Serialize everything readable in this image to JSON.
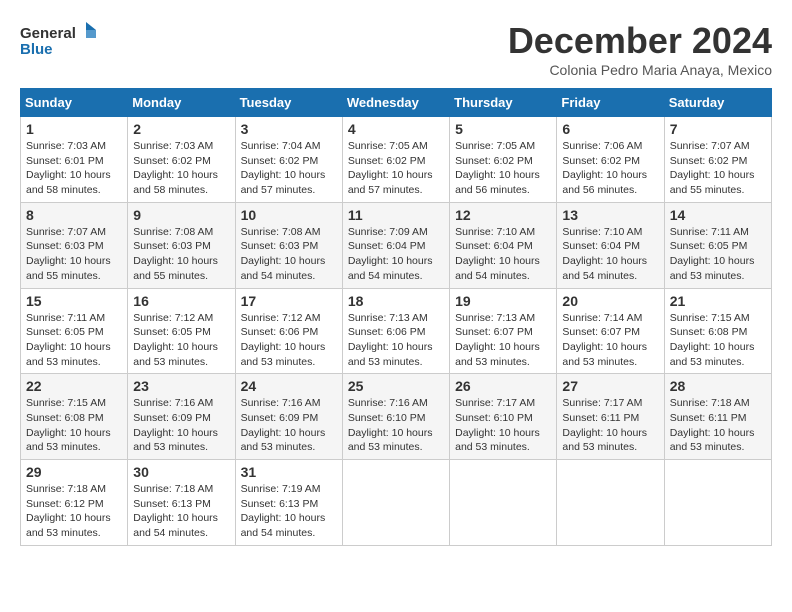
{
  "logo": {
    "line1": "General",
    "line2": "Blue"
  },
  "title": "December 2024",
  "subtitle": "Colonia Pedro Maria Anaya, Mexico",
  "days_of_week": [
    "Sunday",
    "Monday",
    "Tuesday",
    "Wednesday",
    "Thursday",
    "Friday",
    "Saturday"
  ],
  "weeks": [
    [
      {
        "day": "1",
        "info": "Sunrise: 7:03 AM\nSunset: 6:01 PM\nDaylight: 10 hours\nand 58 minutes."
      },
      {
        "day": "2",
        "info": "Sunrise: 7:03 AM\nSunset: 6:02 PM\nDaylight: 10 hours\nand 58 minutes."
      },
      {
        "day": "3",
        "info": "Sunrise: 7:04 AM\nSunset: 6:02 PM\nDaylight: 10 hours\nand 57 minutes."
      },
      {
        "day": "4",
        "info": "Sunrise: 7:05 AM\nSunset: 6:02 PM\nDaylight: 10 hours\nand 57 minutes."
      },
      {
        "day": "5",
        "info": "Sunrise: 7:05 AM\nSunset: 6:02 PM\nDaylight: 10 hours\nand 56 minutes."
      },
      {
        "day": "6",
        "info": "Sunrise: 7:06 AM\nSunset: 6:02 PM\nDaylight: 10 hours\nand 56 minutes."
      },
      {
        "day": "7",
        "info": "Sunrise: 7:07 AM\nSunset: 6:02 PM\nDaylight: 10 hours\nand 55 minutes."
      }
    ],
    [
      {
        "day": "8",
        "info": "Sunrise: 7:07 AM\nSunset: 6:03 PM\nDaylight: 10 hours\nand 55 minutes."
      },
      {
        "day": "9",
        "info": "Sunrise: 7:08 AM\nSunset: 6:03 PM\nDaylight: 10 hours\nand 55 minutes."
      },
      {
        "day": "10",
        "info": "Sunrise: 7:08 AM\nSunset: 6:03 PM\nDaylight: 10 hours\nand 54 minutes."
      },
      {
        "day": "11",
        "info": "Sunrise: 7:09 AM\nSunset: 6:04 PM\nDaylight: 10 hours\nand 54 minutes."
      },
      {
        "day": "12",
        "info": "Sunrise: 7:10 AM\nSunset: 6:04 PM\nDaylight: 10 hours\nand 54 minutes."
      },
      {
        "day": "13",
        "info": "Sunrise: 7:10 AM\nSunset: 6:04 PM\nDaylight: 10 hours\nand 54 minutes."
      },
      {
        "day": "14",
        "info": "Sunrise: 7:11 AM\nSunset: 6:05 PM\nDaylight: 10 hours\nand 53 minutes."
      }
    ],
    [
      {
        "day": "15",
        "info": "Sunrise: 7:11 AM\nSunset: 6:05 PM\nDaylight: 10 hours\nand 53 minutes."
      },
      {
        "day": "16",
        "info": "Sunrise: 7:12 AM\nSunset: 6:05 PM\nDaylight: 10 hours\nand 53 minutes."
      },
      {
        "day": "17",
        "info": "Sunrise: 7:12 AM\nSunset: 6:06 PM\nDaylight: 10 hours\nand 53 minutes."
      },
      {
        "day": "18",
        "info": "Sunrise: 7:13 AM\nSunset: 6:06 PM\nDaylight: 10 hours\nand 53 minutes."
      },
      {
        "day": "19",
        "info": "Sunrise: 7:13 AM\nSunset: 6:07 PM\nDaylight: 10 hours\nand 53 minutes."
      },
      {
        "day": "20",
        "info": "Sunrise: 7:14 AM\nSunset: 6:07 PM\nDaylight: 10 hours\nand 53 minutes."
      },
      {
        "day": "21",
        "info": "Sunrise: 7:15 AM\nSunset: 6:08 PM\nDaylight: 10 hours\nand 53 minutes."
      }
    ],
    [
      {
        "day": "22",
        "info": "Sunrise: 7:15 AM\nSunset: 6:08 PM\nDaylight: 10 hours\nand 53 minutes."
      },
      {
        "day": "23",
        "info": "Sunrise: 7:16 AM\nSunset: 6:09 PM\nDaylight: 10 hours\nand 53 minutes."
      },
      {
        "day": "24",
        "info": "Sunrise: 7:16 AM\nSunset: 6:09 PM\nDaylight: 10 hours\nand 53 minutes."
      },
      {
        "day": "25",
        "info": "Sunrise: 7:16 AM\nSunset: 6:10 PM\nDaylight: 10 hours\nand 53 minutes."
      },
      {
        "day": "26",
        "info": "Sunrise: 7:17 AM\nSunset: 6:10 PM\nDaylight: 10 hours\nand 53 minutes."
      },
      {
        "day": "27",
        "info": "Sunrise: 7:17 AM\nSunset: 6:11 PM\nDaylight: 10 hours\nand 53 minutes."
      },
      {
        "day": "28",
        "info": "Sunrise: 7:18 AM\nSunset: 6:11 PM\nDaylight: 10 hours\nand 53 minutes."
      }
    ],
    [
      {
        "day": "29",
        "info": "Sunrise: 7:18 AM\nSunset: 6:12 PM\nDaylight: 10 hours\nand 53 minutes."
      },
      {
        "day": "30",
        "info": "Sunrise: 7:18 AM\nSunset: 6:13 PM\nDaylight: 10 hours\nand 54 minutes."
      },
      {
        "day": "31",
        "info": "Sunrise: 7:19 AM\nSunset: 6:13 PM\nDaylight: 10 hours\nand 54 minutes."
      },
      {
        "day": "",
        "info": ""
      },
      {
        "day": "",
        "info": ""
      },
      {
        "day": "",
        "info": ""
      },
      {
        "day": "",
        "info": ""
      }
    ]
  ]
}
